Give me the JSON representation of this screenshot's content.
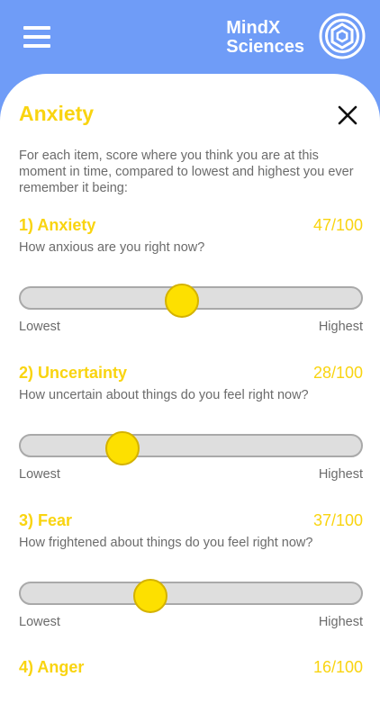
{
  "header": {
    "brand_line1": "MindX",
    "brand_line2": "Sciences",
    "menu_icon": "hamburger-menu-icon",
    "logo_icon": "concentric-hexagon-logo-icon"
  },
  "colors": {
    "header_bg": "#6f9cf7",
    "accent": "#f9d410",
    "thumb": "#fde000",
    "track": "#dedede",
    "text_muted": "#6b6b6b"
  },
  "form": {
    "title": "Anxiety",
    "close_icon": "close-icon",
    "intro": "For each item, score where you think you are at this moment in time, compared to lowest and highest you ever remember it being:",
    "items": [
      {
        "title": "1) Anxiety",
        "score_text": "47/100",
        "score": 47,
        "question": "How anxious are you right now?",
        "low_label": "Lowest",
        "high_label": "Highest"
      },
      {
        "title": "2) Uncertainty",
        "score_text": "28/100",
        "score": 28,
        "question": "How uncertain about things do you feel right now?",
        "low_label": "Lowest",
        "high_label": "Highest"
      },
      {
        "title": "3) Fear",
        "score_text": "37/100",
        "score": 37,
        "question": "How frightened about things do you feel right now?",
        "low_label": "Lowest",
        "high_label": "Highest"
      },
      {
        "title": "4) Anger",
        "score_text": "16/100",
        "score": 16
      }
    ]
  }
}
